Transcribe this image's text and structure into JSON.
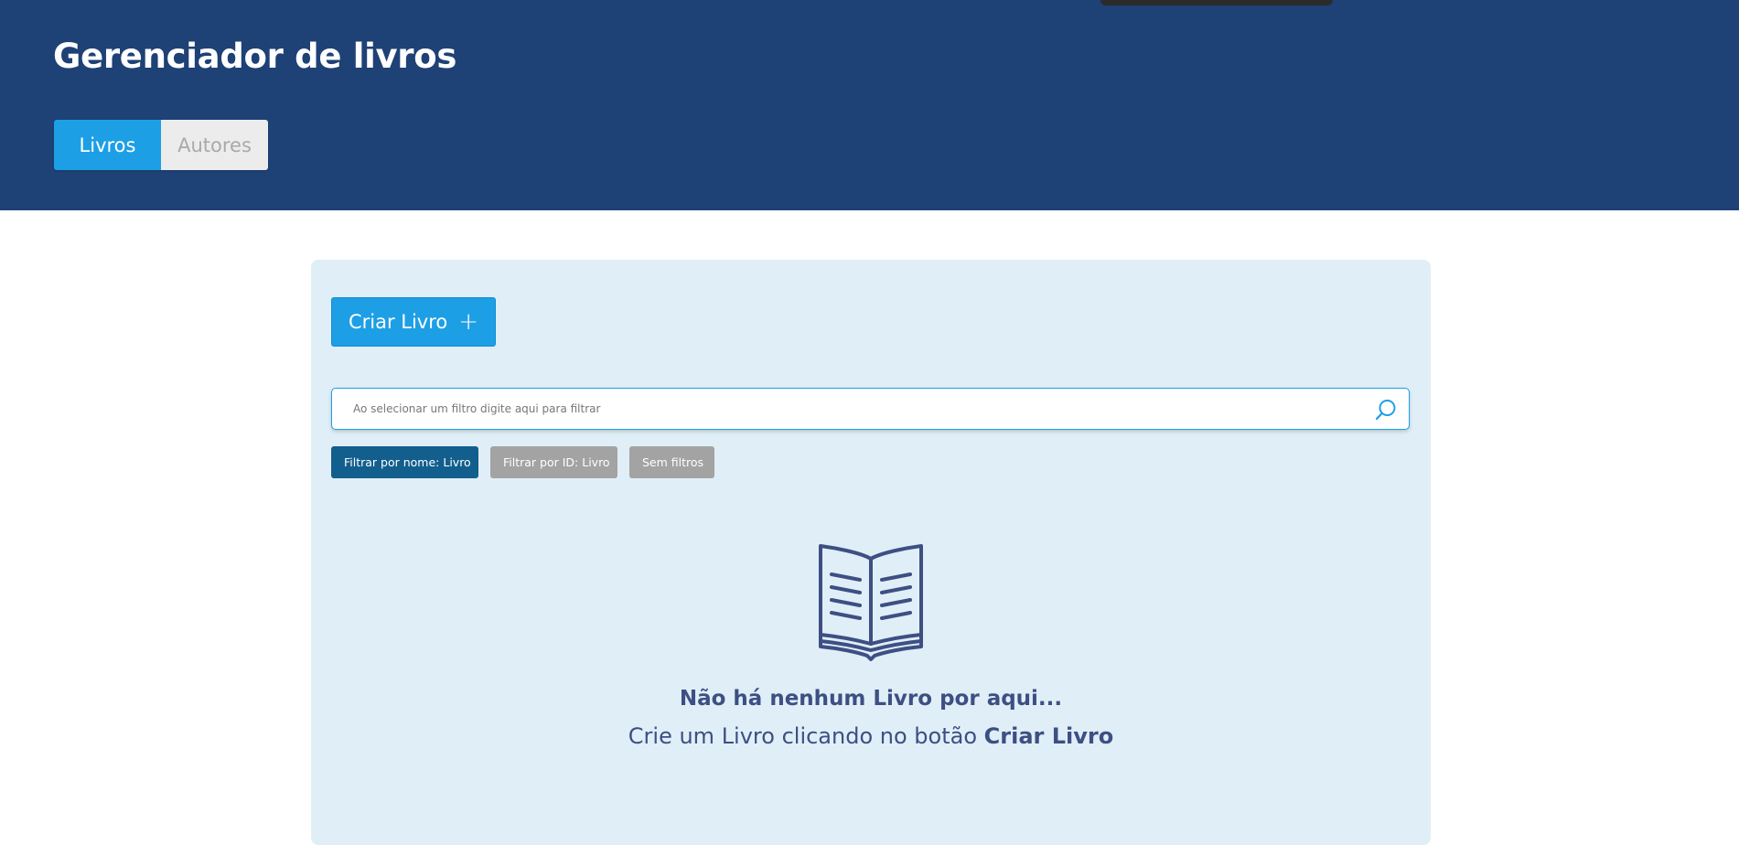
{
  "header": {
    "title": "Gerenciador de livros",
    "tabs": [
      {
        "label": "Livros",
        "active": true
      },
      {
        "label": "Autores",
        "active": false
      }
    ]
  },
  "toolbar": {
    "create_label": "Criar Livro",
    "create_icon": "plus-icon"
  },
  "search": {
    "placeholder": "Ao selecionar um filtro digite aqui para filtrar",
    "value": "",
    "icon": "search-icon"
  },
  "filters": [
    {
      "label": "Filtrar por nome: Livro",
      "active": true
    },
    {
      "label": "Filtrar por ID: Livro",
      "active": false
    },
    {
      "label": "Sem filtros",
      "active": false
    }
  ],
  "empty_state": {
    "icon": "open-book-icon",
    "title": "Não há nenhum Livro por aqui...",
    "hint_prefix": "Crie um Livro clicando no botão",
    "hint_emphasis": "Criar Livro"
  },
  "colors": {
    "header_bg": "#1e4176",
    "accent": "#1d9fe6",
    "filter_active": "#125f8e",
    "filter_muted": "#a3a3a3",
    "panel_bg": "#e0eff7",
    "empty_text": "#3d4f83"
  }
}
